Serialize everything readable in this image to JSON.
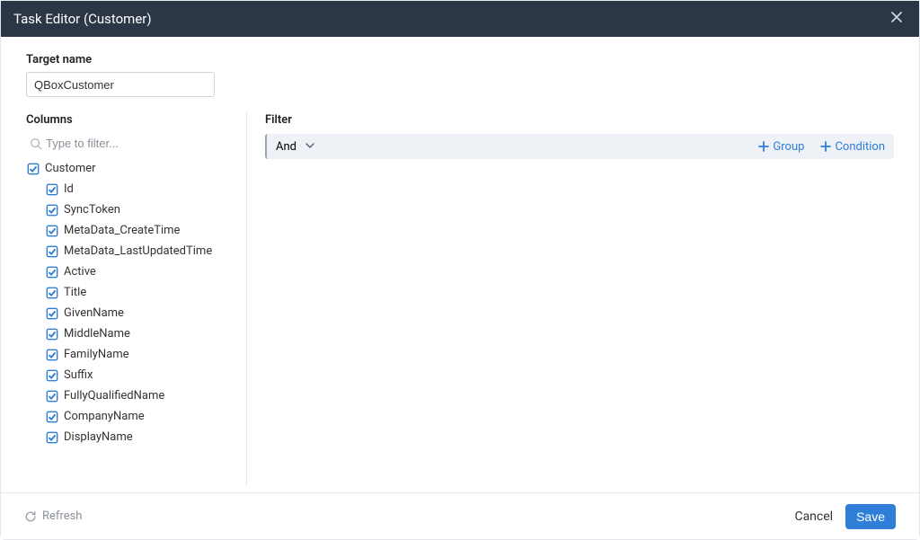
{
  "header": {
    "title": "Task Editor (Customer)"
  },
  "target": {
    "label": "Target name",
    "value": "QBoxCustomer"
  },
  "columns": {
    "title": "Columns",
    "filter_placeholder": "Type to filter...",
    "root": "Customer",
    "items": [
      "Id",
      "SyncToken",
      "MetaData_CreateTime",
      "MetaData_LastUpdatedTime",
      "Active",
      "Title",
      "GivenName",
      "MiddleName",
      "FamilyName",
      "Suffix",
      "FullyQualifiedName",
      "CompanyName",
      "DisplayName"
    ]
  },
  "filter": {
    "title": "Filter",
    "operator": "And",
    "actions": {
      "group": "Group",
      "condition": "Condition"
    }
  },
  "footer": {
    "refresh": "Refresh",
    "cancel": "Cancel",
    "save": "Save"
  }
}
